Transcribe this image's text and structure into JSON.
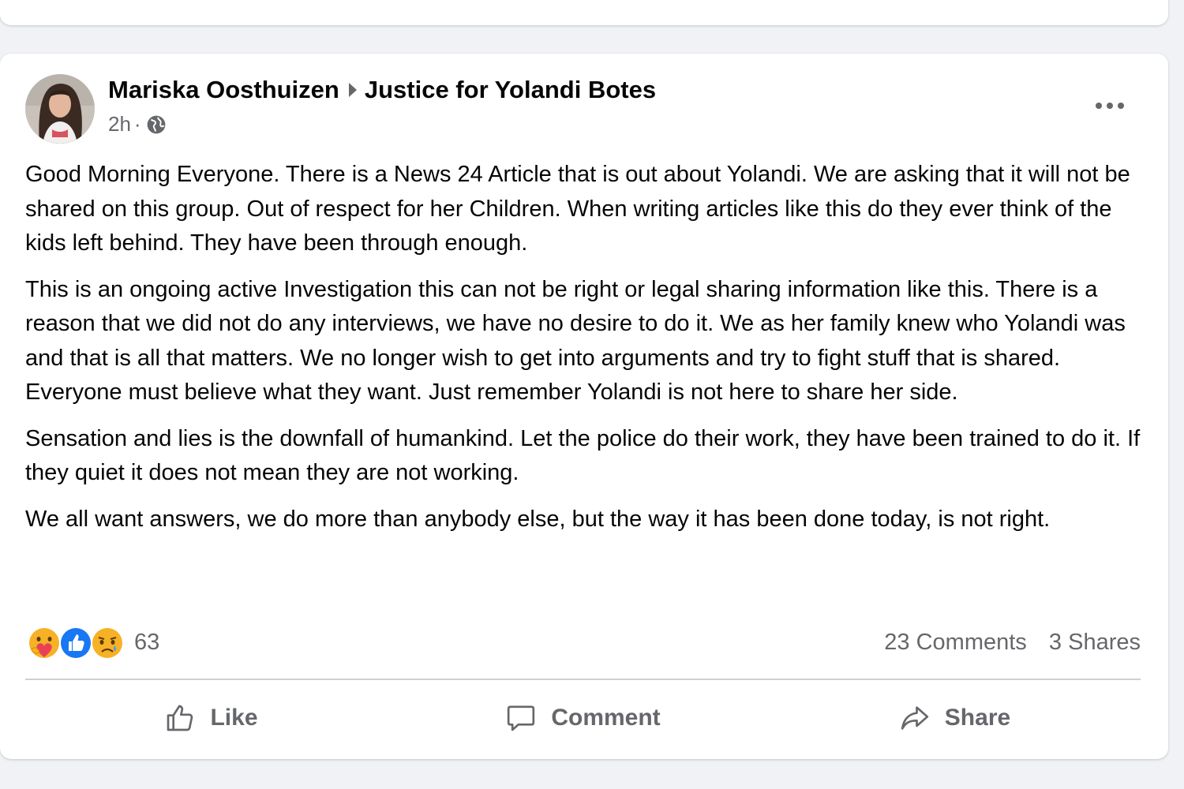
{
  "post": {
    "author": "Mariska Oosthuizen",
    "group": "Justice for Yolandi Botes",
    "time": "2h",
    "separator": "·",
    "paragraphs": [
      "Good Morning Everyone. There is a News 24 Article that is out about Yolandi. We are asking that it will not be shared on this group. Out of respect for her Children. When writing articles like this do they ever think of the kids left behind. They have been through enough.",
      "This is an ongoing active Investigation this can not be right or legal sharing information like this. There is a reason that we did not do any interviews, we have no desire to do it. We as her family knew who Yolandi was and that is all that matters. We no longer wish to get into arguments and try to fight stuff that is shared. Everyone must believe what they want. Just remember Yolandi is not here to share her side.",
      "Sensation and lies is the downfall of humankind. Let the police do their work, they have been trained to do it. If they quiet it does not mean they are not working.",
      "We all want answers, we do more than anybody else, but the way it has been done today, is not right."
    ],
    "reactions": {
      "icons": [
        "care-icon",
        "like-reaction-icon",
        "sad-icon"
      ],
      "count": "63"
    },
    "comments_count": "23 Comments",
    "shares_count": "3 Shares",
    "actions": {
      "like": "Like",
      "comment": "Comment",
      "share": "Share"
    }
  },
  "colors": {
    "background": "#f0f2f5",
    "card": "#ffffff",
    "secondary_text": "#65676b",
    "like_blue": "#1877f2",
    "reaction_yellow": "#f7b125"
  }
}
